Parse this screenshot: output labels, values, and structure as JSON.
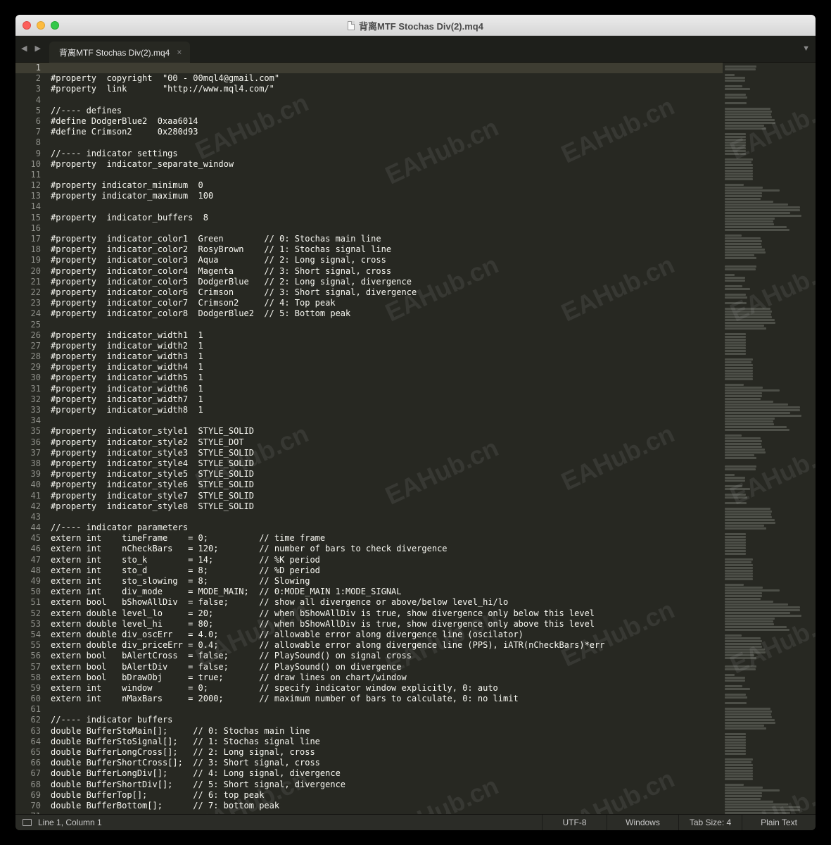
{
  "window": {
    "title": "背离MTF Stochas Div(2).mq4"
  },
  "tabs": [
    {
      "label": "背离MTF Stochas Div(2).mq4"
    }
  ],
  "nav_arrows": "◀ ▶",
  "tab_close": "×",
  "tab_dropdown": "▼",
  "watermark_text": "EAHub.cn",
  "colors": {
    "editor_bg": "#272822",
    "text": "#f8f8f2",
    "gutter_text": "#8f908a",
    "current_line": "#3e3d32"
  },
  "editor": {
    "lines": [
      "",
      "#property  copyright  \"00 - 00mql4@gmail.com\"",
      "#property  link       \"http://www.mql4.com/\"",
      "",
      "//---- defines",
      "#define DodgerBlue2  0xaa6014",
      "#define Crimson2     0x280d93",
      "",
      "//---- indicator settings",
      "#property  indicator_separate_window",
      "",
      "#property indicator_minimum  0",
      "#property indicator_maximum  100",
      "",
      "#property  indicator_buffers  8",
      "",
      "#property  indicator_color1  Green        // 0: Stochas main line",
      "#property  indicator_color2  RosyBrown    // 1: Stochas signal line",
      "#property  indicator_color3  Aqua         // 2: Long signal, cross",
      "#property  indicator_color4  Magenta      // 3: Short signal, cross",
      "#property  indicator_color5  DodgerBlue   // 2: Long signal, divergence",
      "#property  indicator_color6  Crimson      // 3: Short signal, divergence",
      "#property  indicator_color7  Crimson2     // 4: Top peak",
      "#property  indicator_color8  DodgerBlue2  // 5: Bottom peak",
      "",
      "#property  indicator_width1  1",
      "#property  indicator_width2  1",
      "#property  indicator_width3  1",
      "#property  indicator_width4  1",
      "#property  indicator_width5  1",
      "#property  indicator_width6  1",
      "#property  indicator_width7  1",
      "#property  indicator_width8  1",
      "",
      "#property  indicator_style1  STYLE_SOLID",
      "#property  indicator_style2  STYLE_DOT",
      "#property  indicator_style3  STYLE_SOLID",
      "#property  indicator_style4  STYLE_SOLID",
      "#property  indicator_style5  STYLE_SOLID",
      "#property  indicator_style6  STYLE_SOLID",
      "#property  indicator_style7  STYLE_SOLID",
      "#property  indicator_style8  STYLE_SOLID",
      "",
      "//---- indicator parameters",
      "extern int    timeFrame    = 0;          // time frame",
      "extern int    nCheckBars   = 120;        // number of bars to check divergence",
      "extern int    sto_k        = 14;         // %K period",
      "extern int    sto_d        = 8;          // %D period",
      "extern int    sto_slowing  = 8;          // Slowing",
      "extern int    div_mode     = MODE_MAIN;  // 0:MODE_MAIN 1:MODE_SIGNAL",
      "extern bool   bShowAllDiv  = false;      // show all divergence or above/below level_hi/lo",
      "extern double level_lo     = 20;         // when bShowAllDiv is true, show divergence only below this level",
      "extern double level_hi     = 80;         // when bShowAllDiv is true, show divergence only above this level",
      "extern double div_oscErr   = 4.0;        // allowable error along divergence line (oscilator)",
      "extern double div_priceErr = 0.4;        // allowable error along divergence line (PPS), iATR(nCheckBars)*err",
      "extern bool   bAlertCross  = false;      // PlaySound() on signal cross",
      "extern bool   bAlertDiv    = false;      // PlaySound() on divergence",
      "extern bool   bDrawObj     = true;       // draw lines on chart/window",
      "extern int    window       = 0;          // specify indicator window explicitly, 0: auto",
      "extern int    nMaxBars     = 2000;       // maximum number of bars to calculate, 0: no limit",
      "",
      "//---- indicator buffers",
      "double BufferStoMain[];     // 0: Stochas main line",
      "double BufferStoSignal[];   // 1: Stochas signal line",
      "double BufferLongCross[];   // 2: Long signal, cross",
      "double BufferShortCross[];  // 3: Short signal, cross",
      "double BufferLongDiv[];     // 4: Long signal, divergence",
      "double BufferShortDiv[];    // 5: Short signal, divergence",
      "double BufferTop[];         // 6: top peak",
      "double BufferBottom[];      // 7: bottom peak",
      ""
    ]
  },
  "statusbar": {
    "position": "Line 1, Column 1",
    "encoding": "UTF-8",
    "line_endings": "Windows",
    "tab_size": "Tab Size: 4",
    "syntax": "Plain Text"
  }
}
